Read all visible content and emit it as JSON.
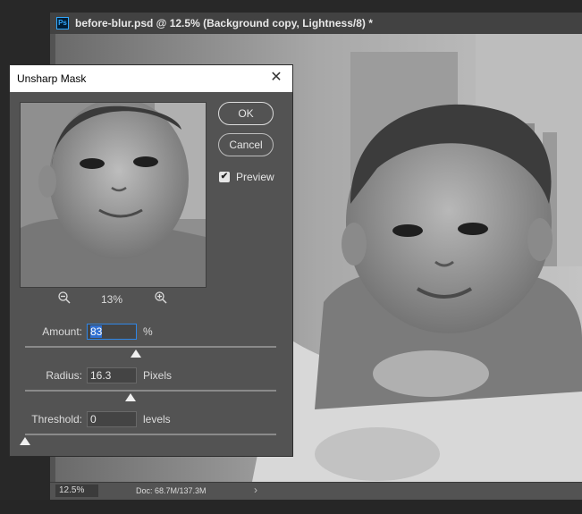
{
  "document": {
    "app_badge": "Ps",
    "title": "before-blur.psd @ 12.5% (Background copy, Lightness/8) *",
    "status_zoom": "12.5%",
    "status_doc": "Doc: 68.7M/137.3M",
    "status_arrow": "›"
  },
  "dialog": {
    "title": "Unsharp Mask",
    "close": "✕",
    "ok_label": "OK",
    "cancel_label": "Cancel",
    "preview_label": "Preview",
    "preview_checked": true,
    "check_glyph": "✔",
    "zoom_value": "13%",
    "amount": {
      "label": "Amount:",
      "value": "83",
      "unit": "%",
      "slider_fraction": 0.44
    },
    "radius": {
      "label": "Radius:",
      "value": "16.3",
      "unit": "Pixels",
      "slider_fraction": 0.42
    },
    "threshold": {
      "label": "Threshold:",
      "value": "0",
      "unit": "levels",
      "slider_fraction": 0.0
    }
  },
  "colors": {
    "accent": "#2f86e6",
    "panel": "#535353",
    "app_bg": "#282828"
  }
}
